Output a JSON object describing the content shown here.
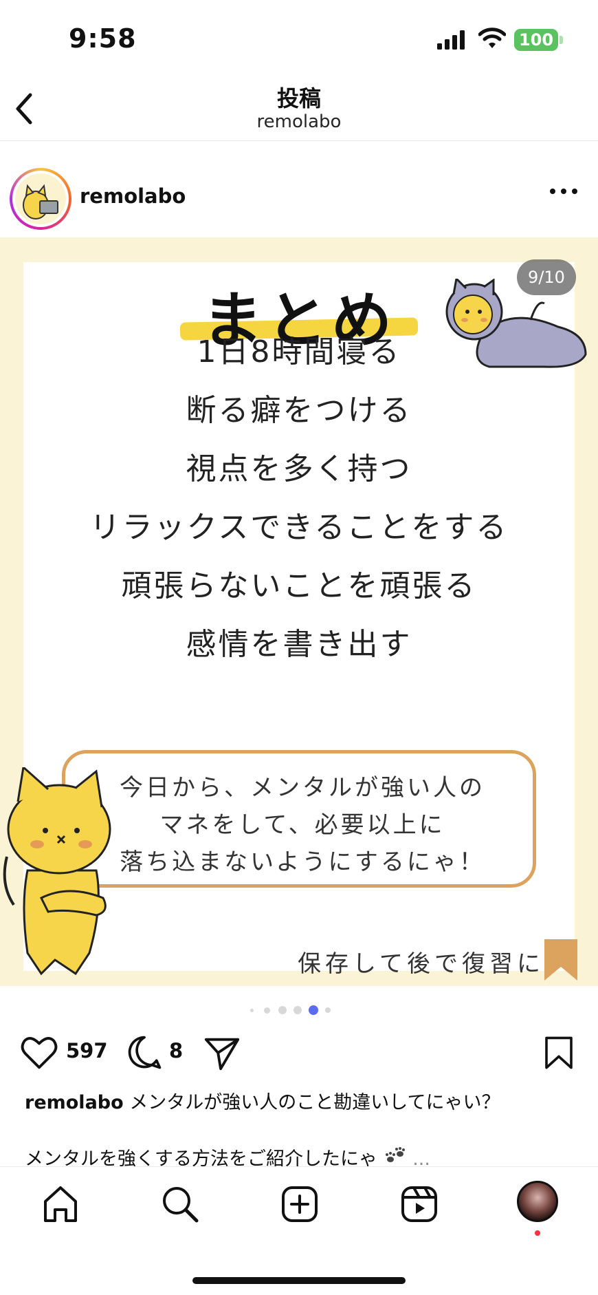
{
  "status_bar": {
    "time": "9:58",
    "battery": "100"
  },
  "header": {
    "title": "投稿",
    "subtitle": "remolabo"
  },
  "post": {
    "username": "remolabo",
    "image": {
      "counter": "9/10",
      "headline": "まとめ",
      "items": [
        "1日8時間寝る",
        "断る癖をつける",
        "視点を多く持つ",
        "リラックスできることをする",
        "頑張らないことを頑張る",
        "感情を書き出す"
      ],
      "bubble_lines": [
        "今日から、メンタルが強い人の",
        "マネをして、必要以上に",
        "落ち込まないようにするにゃ！"
      ],
      "save_text": "保存して後で復習にゃ！"
    },
    "carousel": {
      "total_dots": 6,
      "active_index": 4
    },
    "likes": "597",
    "comments": "8",
    "caption": {
      "username": "remolabo",
      "text": "メンタルが強い人のこと勘違いしてにゃい？",
      "line2": "メンタルを強くする方法をご紹介したにゃ",
      "more": "..."
    }
  },
  "colors": {
    "accent_yellow": "#f5d540",
    "bubble_border": "#dca35e",
    "active_dot": "#5b6cf0",
    "background_cream": "#faf3d5"
  },
  "icons": [
    "back-icon",
    "more-icon",
    "heart-icon",
    "comment-icon",
    "share-icon",
    "bookmark-icon",
    "home-icon",
    "search-icon",
    "create-icon",
    "reels-icon"
  ]
}
